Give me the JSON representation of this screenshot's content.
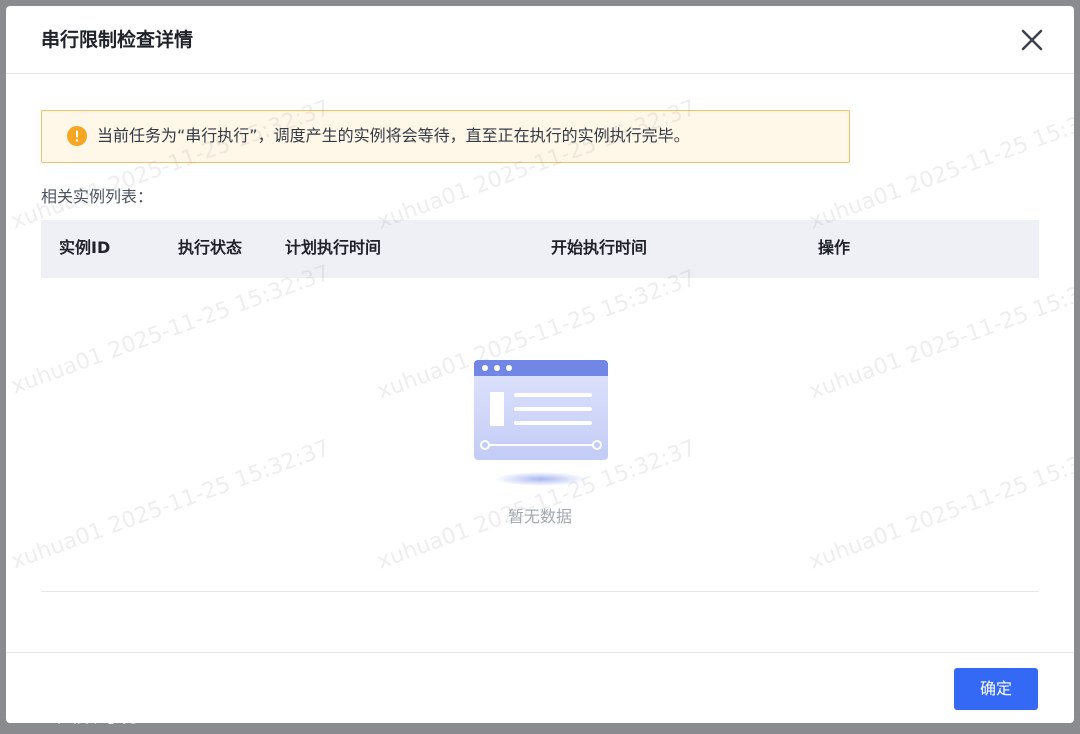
{
  "dialog": {
    "title": "串行限制检查详情",
    "close_icon": "close-icon"
  },
  "alert": {
    "icon": "warning-icon",
    "text": "当前任务为“串行执行”，调度产生的实例将会等待，直至正在执行的实例执行完毕。",
    "color": "#f5a623"
  },
  "section_label": "相关实例列表：",
  "table": {
    "columns": [
      "实例ID",
      "执行状态",
      "计划执行时间",
      "开始执行时间",
      "操作"
    ],
    "rows": [],
    "empty_icon": "empty-data-icon",
    "empty_text": "暂无数据"
  },
  "footer": {
    "confirm_label": "确定",
    "confirm_color": "#3469f5"
  },
  "watermark": {
    "text": "xuhua01 2025-11-25 15:32:37"
  },
  "brand": {
    "logo_icon": "brand-logo-icon",
    "text": "大数跨境"
  }
}
